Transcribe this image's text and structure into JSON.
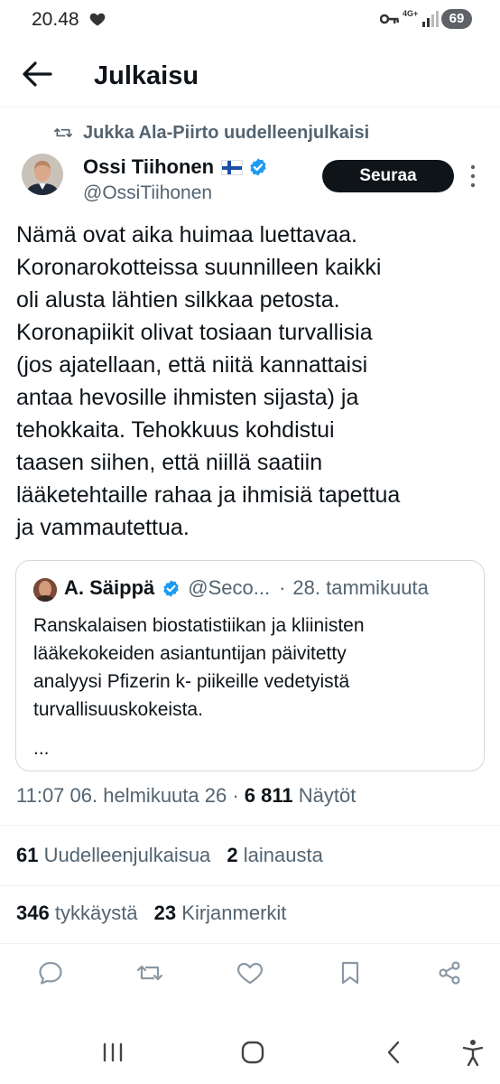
{
  "status_bar": {
    "time": "20.48",
    "network": "4G+",
    "battery": "69"
  },
  "header": {
    "title": "Julkaisu"
  },
  "repost": {
    "text": "Jukka Ala-Piirto uudelleenjulkaisi"
  },
  "author": {
    "name": "Ossi Tiihonen",
    "handle": "@OssiTiihonen",
    "follow_label": "Seuraa"
  },
  "tweet": {
    "text": "Nämä ovat aika huimaa luettavaa.\nKoronarokotteissa suunnilleen kaikki\noli alusta lähtien silkkaa petosta.\nKoronapiikit olivat tosiaan turvallisia\n(jos ajatellaan, että niitä kannattaisi\nantaa hevosille ihmisten sijasta) ja\ntehokkaita. Tehokkuus kohdistui\ntaasen siihen, että  niillä saatiin\nlääketehtaille rahaa ja ihmisiä tapettua\nja vammautettua."
  },
  "quote": {
    "name": "A. Säippä",
    "handle": "@Seco...",
    "date": "28. tammikuuta",
    "text": "Ranskalaisen biostatistiikan ja kliinisten\nlääkekokeiden asiantuntijan päivitetty\nanalyysi Pfizerin k- piikeille vedetyistä\nturvallisuuskokeista.",
    "ellipsis": "..."
  },
  "meta": {
    "time": "11:07",
    "date": "06. helmikuuta 26",
    "views_count": "6 811",
    "views_label": "Näytöt"
  },
  "stats": {
    "reposts_count": "61",
    "reposts_label": "Uudelleenjulkaisua",
    "quotes_count": "2",
    "quotes_label": "lainausta",
    "likes_count": "346",
    "likes_label": "tykkäystä",
    "bookmarks_count": "23",
    "bookmarks_label": "Kirjanmerkit"
  },
  "actions": [
    "reply-icon",
    "repost-icon",
    "like-icon",
    "bookmark-icon",
    "share-icon"
  ],
  "colors": {
    "text": "#0f1419",
    "secondary": "#536471",
    "verified": "#1d9bf0",
    "border": "#cfd9de"
  }
}
